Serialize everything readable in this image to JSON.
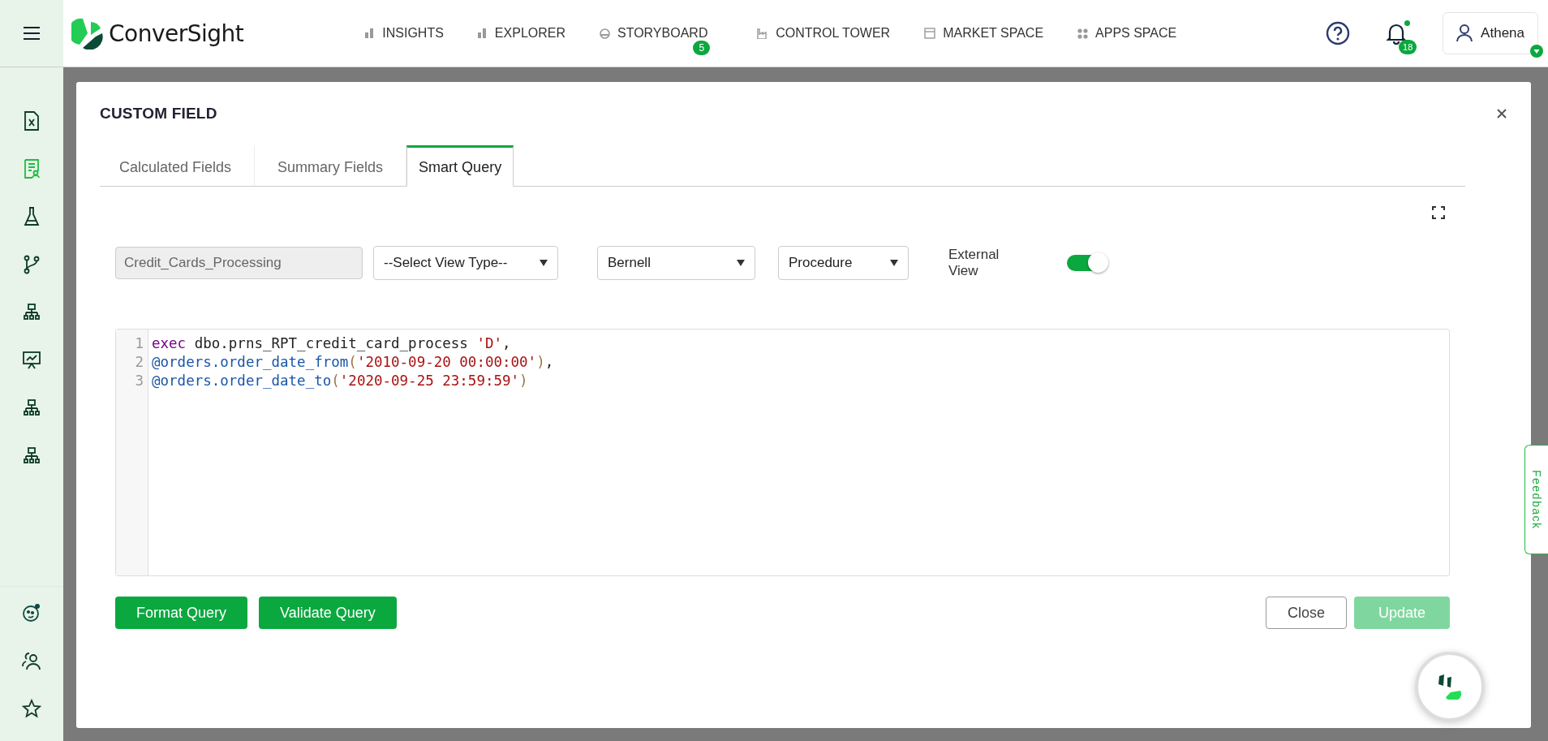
{
  "brand": {
    "name": "ConverSight"
  },
  "nav": [
    {
      "label": "INSIGHTS"
    },
    {
      "label": "EXPLORER"
    },
    {
      "label": "STORYBOARD",
      "badge": "5"
    },
    {
      "label": "CONTROL TOWER"
    },
    {
      "label": "MARKET SPACE"
    },
    {
      "label": "APPS SPACE"
    }
  ],
  "notifications": {
    "count": "18",
    "unread": true
  },
  "user": {
    "name": "Athena"
  },
  "sidebar": {
    "items": [
      {
        "selected": false
      },
      {
        "selected": true
      },
      {
        "selected": false
      },
      {
        "selected": false
      },
      {
        "selected": false
      },
      {
        "selected": false
      },
      {
        "selected": false
      },
      {
        "selected": false
      }
    ]
  },
  "modal": {
    "title": "CUSTOM FIELD",
    "tabs": [
      {
        "label": "Calculated Fields",
        "selected": false
      },
      {
        "label": "Summary Fields",
        "selected": false
      },
      {
        "label": "Smart Query",
        "selected": true
      }
    ],
    "name_field": {
      "value": "Credit_Cards_Processing",
      "disabled": true
    },
    "view_type": {
      "value": "--Select View Type--"
    },
    "connection": {
      "value": "Bernell"
    },
    "query_type": {
      "value": "Procedure"
    },
    "external_view": {
      "label": "External View",
      "on": true
    },
    "code": [
      [
        {
          "kind": "keyword",
          "text": "exec"
        },
        {
          "kind": "plain",
          "text": " dbo.prns_RPT_credit_card_process "
        },
        {
          "kind": "string",
          "text": "'D'"
        },
        {
          "kind": "plain",
          "text": ","
        }
      ],
      [
        {
          "kind": "variable",
          "text": "@orders.order_date_from"
        },
        {
          "kind": "paren",
          "text": "("
        },
        {
          "kind": "string",
          "text": "'2010-09-20 00:00:00'"
        },
        {
          "kind": "paren",
          "text": ")"
        },
        {
          "kind": "plain",
          "text": ","
        }
      ],
      [
        {
          "kind": "variable",
          "text": "@orders.order_date_to"
        },
        {
          "kind": "paren",
          "text": "("
        },
        {
          "kind": "string",
          "text": "'2020-09-25 23:59:59'"
        },
        {
          "kind": "paren",
          "text": ")"
        }
      ]
    ],
    "line_numbers": [
      "1",
      "2",
      "3"
    ],
    "buttons_left": [
      {
        "label": "Format Query",
        "disabled": false
      },
      {
        "label": "Validate Query",
        "disabled": false
      }
    ],
    "buttons_right": [
      {
        "label": "Close",
        "kind": "outline",
        "disabled": false
      },
      {
        "label": "Update",
        "kind": "primary",
        "disabled": true
      }
    ]
  },
  "feedback": {
    "label": "Feedback"
  }
}
